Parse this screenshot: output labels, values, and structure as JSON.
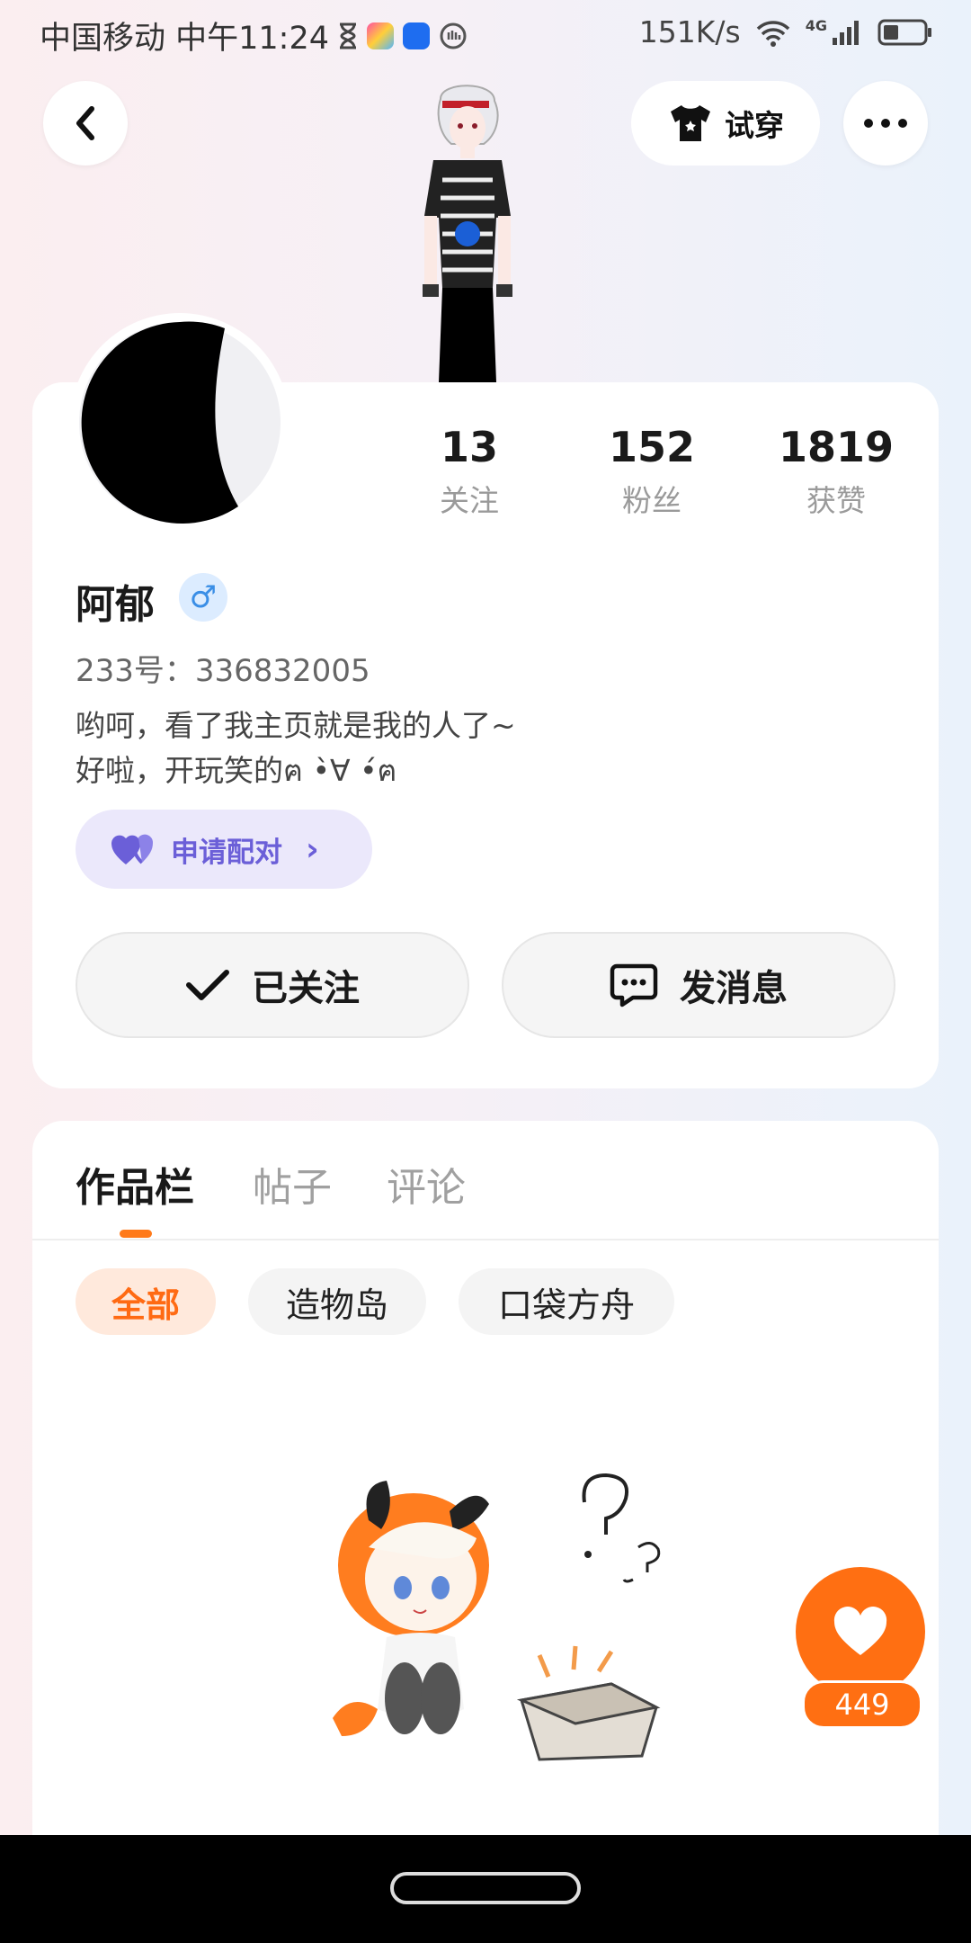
{
  "status_bar": {
    "carrier_time": "中国移动 中午11:24",
    "net_speed": "151K/s",
    "signal_label": "4G",
    "colors": {
      "app_icon_1": "#ff4fa3",
      "app_icon_2": "#1e6df0",
      "app_icon_3": "#555555"
    }
  },
  "header": {
    "back_icon": "chevron-left-icon",
    "tryon_label": "试穿",
    "tryon_icon": "tshirt-icon",
    "more_icon": "more-dots-icon"
  },
  "profile": {
    "stats": [
      {
        "num": "13",
        "label": "关注"
      },
      {
        "num": "152",
        "label": "粉丝"
      },
      {
        "num": "1819",
        "label": "获赞"
      }
    ],
    "name": "阿郁",
    "gender_symbol": "♂",
    "uid": "233号：336832005",
    "bio_line1": "哟呵，看了我主页就是我的人了~",
    "bio_line2": "好啦，开玩笑的ฅ •̀∀ •́ฅ",
    "pair_label": "申请配对",
    "follow_label": "已关注",
    "message_label": "发消息"
  },
  "tabs": [
    {
      "label": "作品栏",
      "active": true
    },
    {
      "label": "帖子",
      "active": false
    },
    {
      "label": "评论",
      "active": false
    }
  ],
  "filters": [
    {
      "label": "全部",
      "active": true
    },
    {
      "label": "造物岛",
      "active": false
    },
    {
      "label": "口袋方舟",
      "active": false
    }
  ],
  "like_fab": {
    "count": "449",
    "color": "#ff6f12"
  }
}
